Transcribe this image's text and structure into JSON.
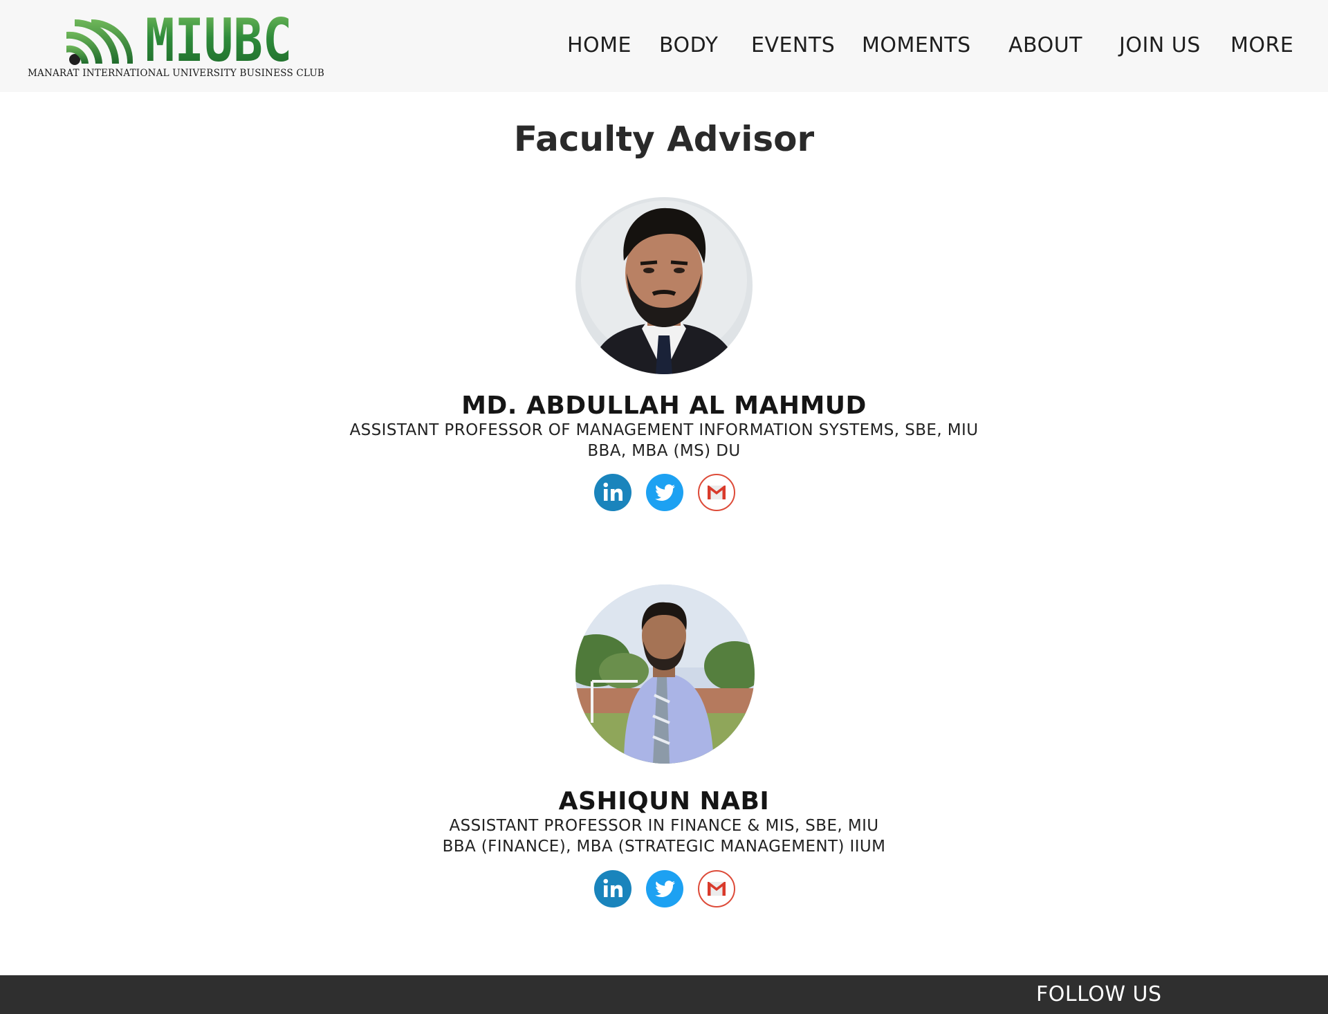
{
  "header": {
    "logo_text": "MIUBC",
    "logo_subtitle": "MANARAT INTERNATIONAL UNIVERSITY BUSINESS CLUB",
    "nav": [
      "HOME",
      "BODY",
      "EVENTS",
      "MOMENTS",
      "ABOUT",
      "JOIN US",
      "MORE"
    ]
  },
  "main": {
    "title": "Faculty Advisor",
    "advisors": [
      {
        "name": "MD. ABDULLAH AL MAHMUD",
        "position": "ASSISTANT PROFESSOR OF MANAGEMENT INFORMATION SYSTEMS, SBE, MIU",
        "degrees": "BBA, MBA (MS) DU"
      },
      {
        "name": "ASHIQUN NABI",
        "position": "ASSISTANT PROFESSOR IN FINANCE & MIS, SBE, MIU",
        "degrees": "BBA (FINANCE), MBA (STRATEGIC MANAGEMENT) IIUM"
      }
    ],
    "social_icons": [
      "linkedin-icon",
      "twitter-icon",
      "gmail-icon"
    ]
  },
  "footer": {
    "follow_label": "FOLLOW US"
  },
  "colors": {
    "header_bg": "#f7f7f7",
    "brand_green": "#2e8b3a",
    "linkedin_blue": "#1a84bc",
    "twitter_blue": "#1da1f2",
    "gmail_red": "#dd4b39",
    "footer_bg": "#2f2f2f"
  }
}
